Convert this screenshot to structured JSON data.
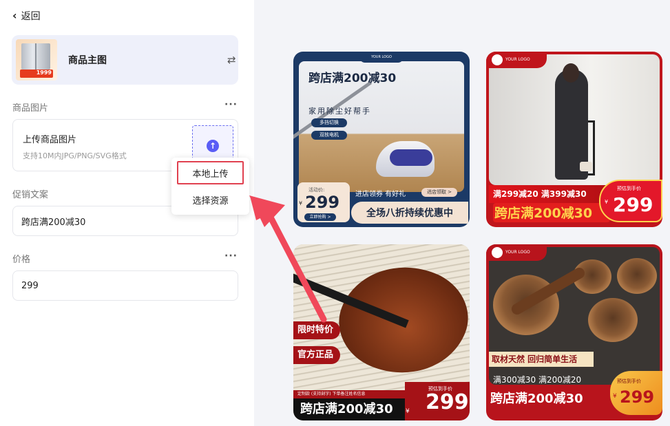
{
  "header": {
    "back_label": "返回"
  },
  "template": {
    "title": "商品主图",
    "thumb_price": "1999"
  },
  "sections": {
    "image": {
      "label": "商品图片",
      "upload_title": "上传商品图片",
      "upload_hint": "支持10M内JPG/PNG/SVG格式"
    },
    "promo": {
      "label": "促销文案",
      "value": "跨店满200减30"
    },
    "price": {
      "label": "价格",
      "value": "299"
    }
  },
  "dropdown": {
    "items": [
      "本地上传",
      "选择资源"
    ]
  },
  "colors": {
    "accent": "#5a5df5",
    "highlight": "#e0404f",
    "arrow": "#f0485a"
  },
  "posters": {
    "p1": {
      "logo": "YOUR LOGO",
      "headline": "跨店满200减30",
      "sub": "家用除尘好帮手",
      "pills": [
        "多挡切换",
        "双核电机"
      ],
      "price_label": "活动价:",
      "yen": "¥",
      "price": "299",
      "buy": "立即抢购 >",
      "bar_text": "进店领券 有好礼",
      "bar_btn": "进店领取 >",
      "bottom": "全场八折持续优惠中"
    },
    "p2": {
      "logo": "YOUR LOGO",
      "deals": "满299减20  满399减30",
      "big": "跨店满200减30",
      "est": "预估到手价",
      "yen": "¥",
      "price": "299"
    },
    "p3": {
      "tag1": "限时特价",
      "tag2": "官方正品",
      "small": "定制款 (支持刻字) 下单备注姓名信息",
      "big": "跨店满200减30",
      "est": "预估到手价",
      "yen": "¥",
      "price": "299"
    },
    "p4": {
      "logo": "YOUR LOGO",
      "slogan": "取材天然 回归简单生活",
      "deals": "满300减30  满200减20",
      "big": "跨店满200减30",
      "est": "预估到手价",
      "yen": "¥",
      "price": "299"
    }
  }
}
